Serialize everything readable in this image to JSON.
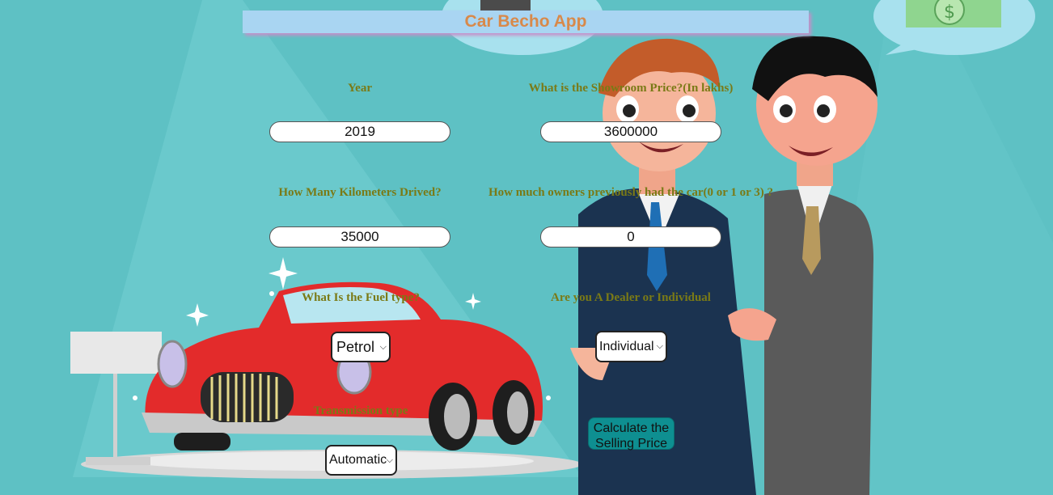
{
  "app": {
    "title": "Car Becho App"
  },
  "form": {
    "year": {
      "label": "Year",
      "value": "2019"
    },
    "showroom_price": {
      "label": "What is the Showroom Price?(In lakhs)",
      "value": "3600000"
    },
    "kms_driven": {
      "label": "How Many Kilometers Drived?",
      "value": "35000"
    },
    "owners": {
      "label": "How much owners previously had the car(0 or 1 or 3) ?",
      "value": "0"
    },
    "fuel_type": {
      "label": "What Is the Fuel type?",
      "selected": "Petrol"
    },
    "seller_type": {
      "label": "Are you A Dealer or Individual",
      "selected": "Individual"
    },
    "transmission": {
      "label": "Transmission type",
      "selected": "Automatic"
    },
    "submit_label": "Calculate the Selling Price"
  },
  "colors": {
    "background": "#5ec1c4",
    "title_bar": "#a9d5f2",
    "title_text": "#d8894a",
    "label_text": "#7a7a16",
    "button": "#0e8f91"
  }
}
